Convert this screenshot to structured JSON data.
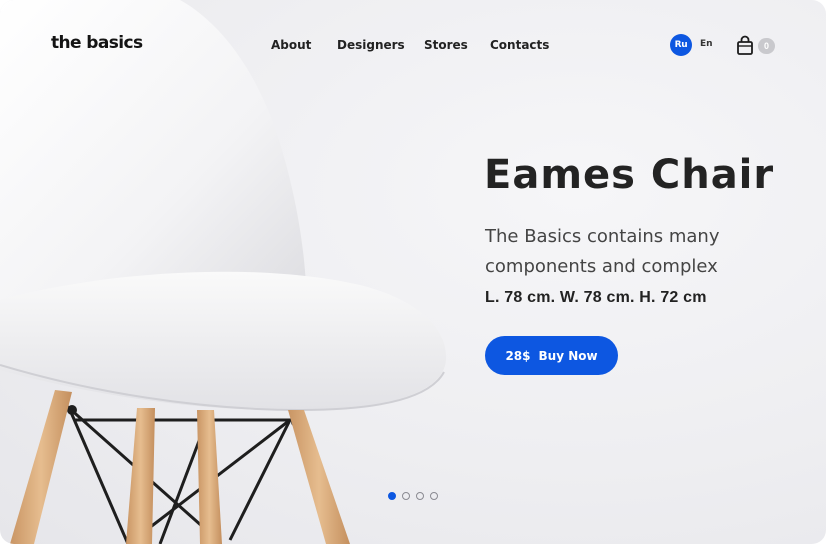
{
  "header": {
    "logo": "the basics",
    "nav": [
      {
        "label": "About"
      },
      {
        "label": "Designers"
      },
      {
        "label": "Stores"
      },
      {
        "label": "Contacts"
      }
    ],
    "languages": {
      "active": "Ru",
      "other": "En"
    },
    "cart": {
      "icon": "shopping-bag-icon",
      "count": "0"
    }
  },
  "hero": {
    "title": "Eames Chair",
    "description": "The Basics contains many components and complex",
    "dimensions": "L. 78 cm. W. 78 cm. H. 72 cm",
    "price": "28$",
    "buy_label": "Buy Now"
  },
  "slider": {
    "total": 4,
    "active_index": 0
  },
  "colors": {
    "accent": "#0d57e1",
    "text": "#232323",
    "background": "#eeeef1"
  }
}
